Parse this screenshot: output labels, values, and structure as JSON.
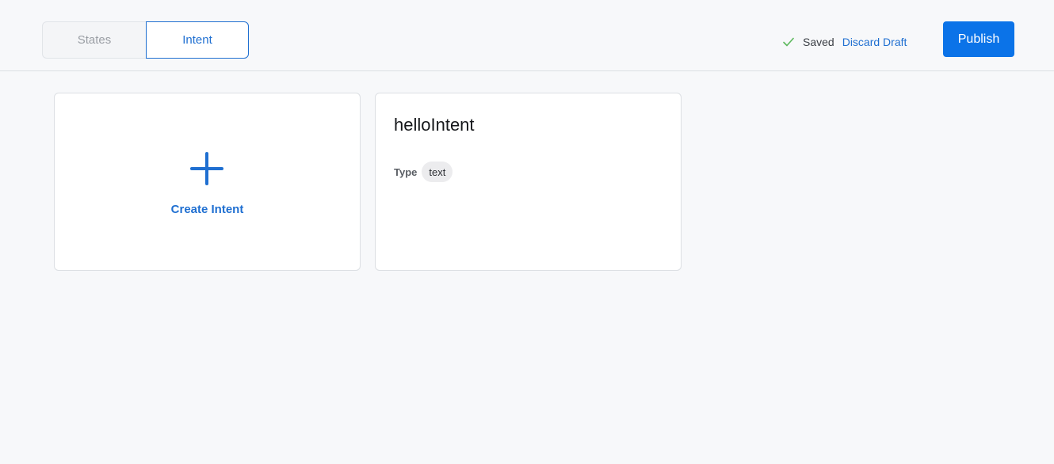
{
  "tabs": [
    {
      "label": "States",
      "active": false
    },
    {
      "label": "Intent",
      "active": true
    }
  ],
  "status": {
    "saved_label": "Saved",
    "discard_label": "Discard Draft"
  },
  "toolbar": {
    "publish_label": "Publish"
  },
  "create_card": {
    "icon": "plus-icon",
    "label": "Create Intent"
  },
  "intents": [
    {
      "name": "helloIntent",
      "type_label": "Type",
      "type_value": "text"
    }
  ],
  "colors": {
    "accent": "#1f6fd1",
    "publish": "#0b73e8",
    "saved_check": "#5cb85c"
  }
}
